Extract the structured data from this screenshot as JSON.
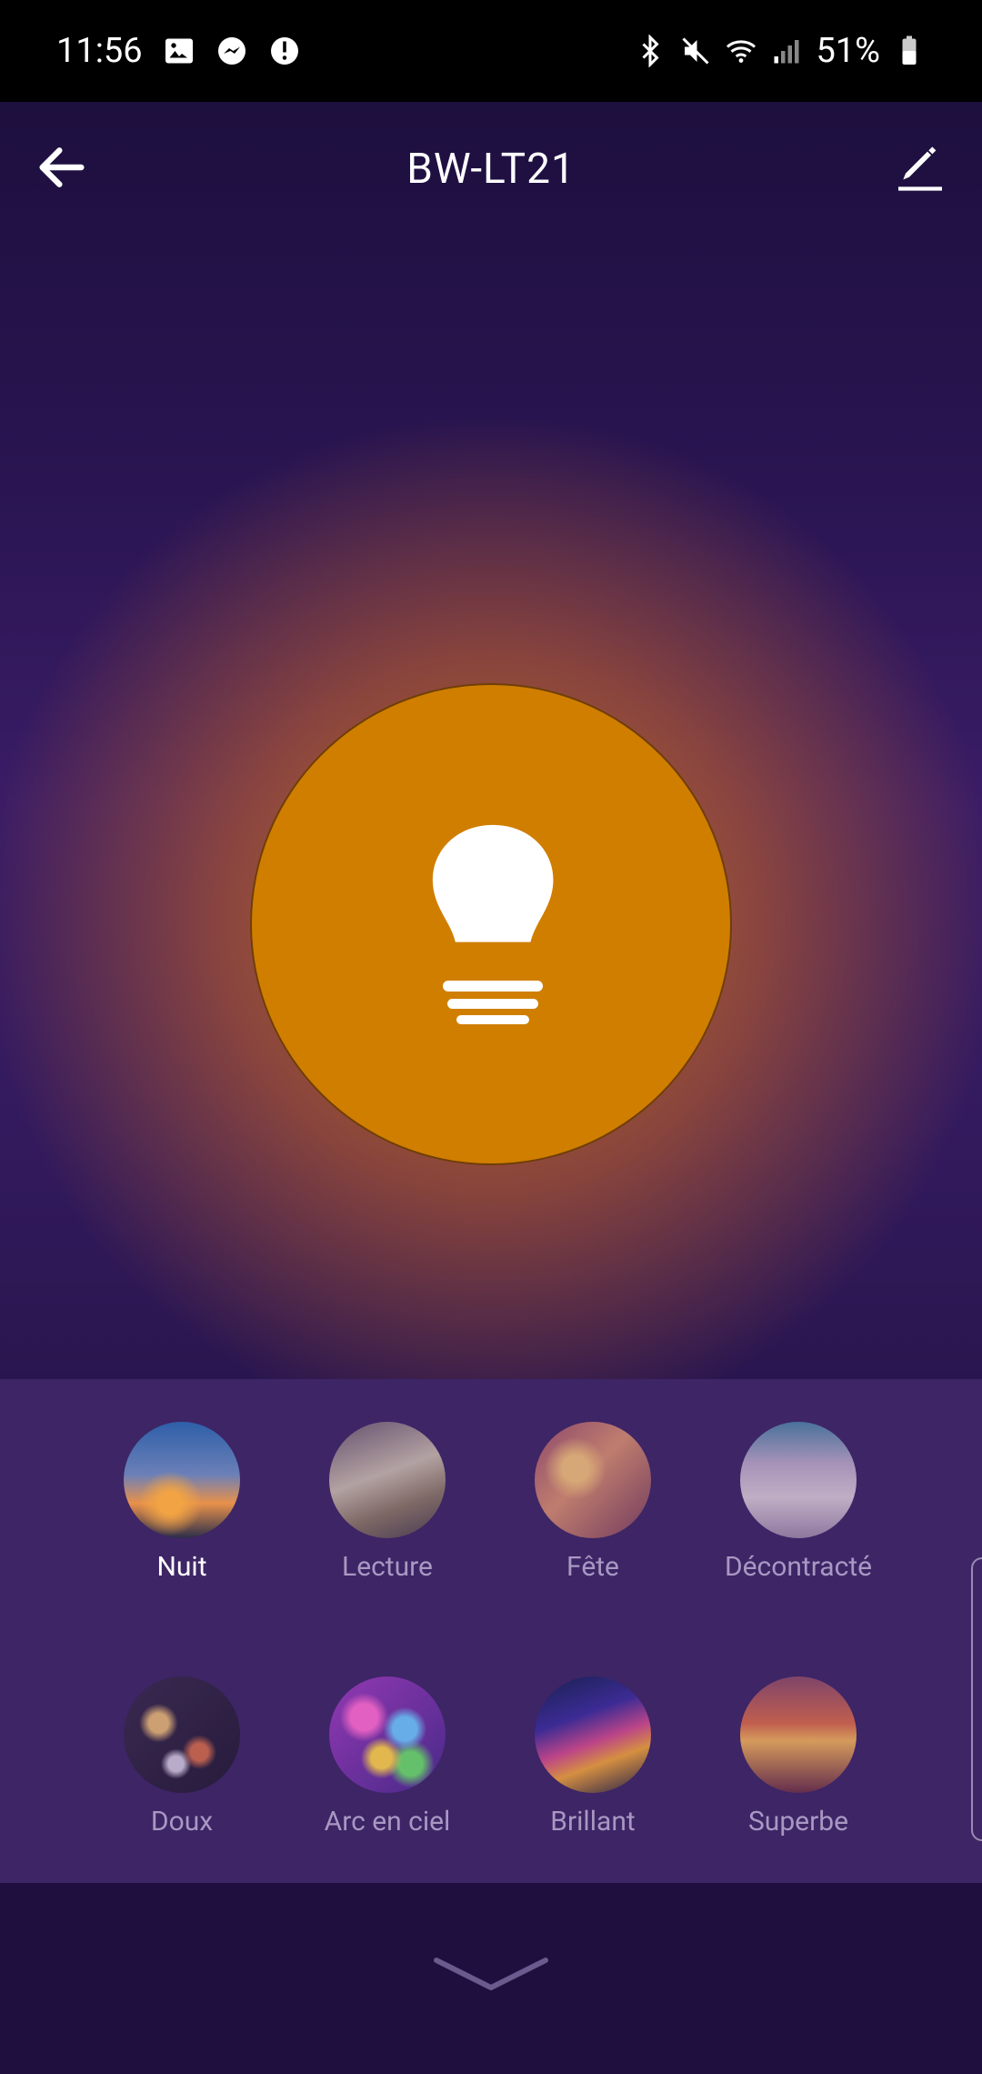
{
  "status_bar": {
    "time": "11:56",
    "battery": "51%",
    "icons_left": [
      "gallery-icon",
      "messenger-icon",
      "alert-icon"
    ],
    "icons_right": [
      "bluetooth-icon",
      "mute-icon",
      "wifi-icon",
      "signal-icon",
      "battery-icon"
    ]
  },
  "header": {
    "title": "BW-LT21",
    "back_icon": "back-arrow-icon",
    "edit_icon": "edit-pencil-icon"
  },
  "bulb": {
    "state": "on",
    "color": "#d07e00",
    "icon": "lightbulb-icon"
  },
  "scenes": [
    {
      "label": "Nuit",
      "active": true
    },
    {
      "label": "Lecture",
      "active": false
    },
    {
      "label": "Fête",
      "active": false
    },
    {
      "label": "Décontracté",
      "active": false
    },
    {
      "label": "Doux",
      "active": false
    },
    {
      "label": "Arc en ciel",
      "active": false
    },
    {
      "label": "Brillant",
      "active": false
    },
    {
      "label": "Superbe",
      "active": false
    }
  ],
  "footer": {
    "collapse_icon": "chevron-down-icon"
  }
}
